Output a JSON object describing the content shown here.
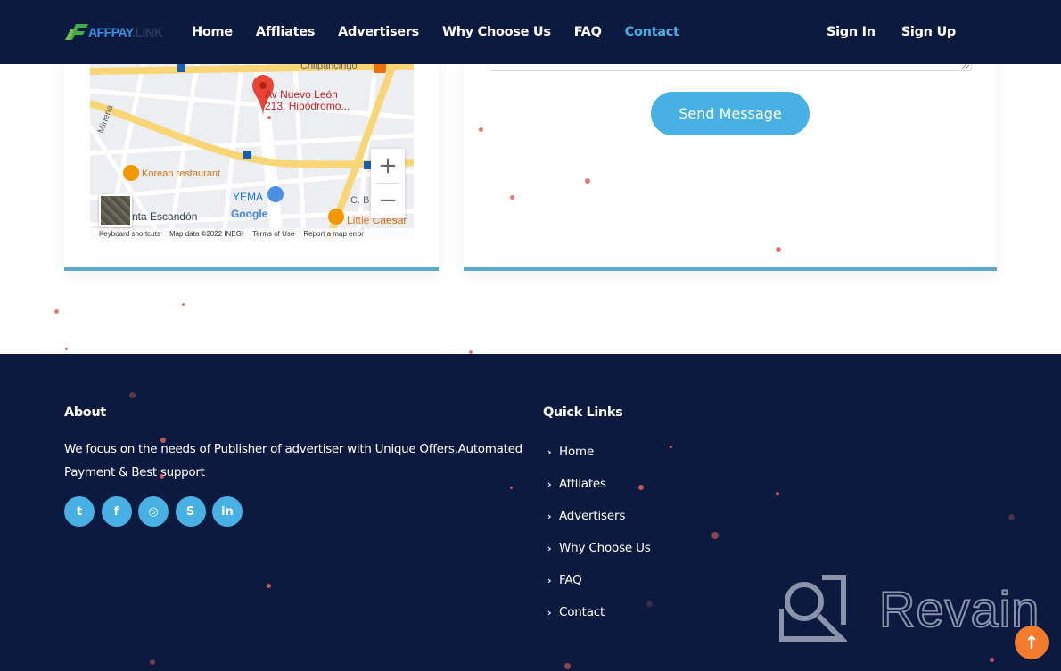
{
  "navbar": {
    "logo": {
      "part1": "AFFPAY",
      "part2": ".LINK"
    },
    "links": [
      {
        "label": "Home",
        "active": false
      },
      {
        "label": "Affliates",
        "active": false
      },
      {
        "label": "Advertisers",
        "active": false
      },
      {
        "label": "Why Choose Us",
        "active": false
      },
      {
        "label": "FAQ",
        "active": false
      },
      {
        "label": "Contact",
        "active": true
      }
    ],
    "sign_in": "Sign In",
    "sign_up": "Sign Up"
  },
  "map": {
    "place_line1": "Av Nuevo León",
    "place_line2": "213, Hipódromo...",
    "labels": {
      "korean": "Korean restaurant",
      "yema": "YEMA",
      "escandon": "nta Escandón",
      "caesar": "Little Caesar",
      "mineria": "Mineria",
      "chilpancingo": "Chilpancingo",
      "cba": "C. B",
      "google": "Google"
    },
    "zoom_in": "+",
    "zoom_out": "−",
    "footer": {
      "shortcuts": "Keyboard shortcuts",
      "map_data": "Map data ©2022 INEGI",
      "terms": "Terms of Use",
      "report": "Report a map error"
    }
  },
  "contact_form": {
    "message_value": "",
    "send_label": "Send Message"
  },
  "footer": {
    "about_heading": "About",
    "about_text": "We focus on the needs of Publisher of advertiser with Unique Offers,Automated Payment & Best support",
    "socials": [
      {
        "name": "twitter",
        "glyph": "t"
      },
      {
        "name": "facebook",
        "glyph": "f"
      },
      {
        "name": "instagram",
        "glyph": "◎"
      },
      {
        "name": "skype",
        "glyph": "S"
      },
      {
        "name": "linkedin",
        "glyph": "in"
      }
    ],
    "quick_links_heading": "Quick Links",
    "quick_links": [
      "Home",
      "Affliates",
      "Advertisers",
      "Why Choose Us",
      "FAQ",
      "Contact"
    ],
    "watermark": "Revain",
    "back_to_top": "↑"
  },
  "colors": {
    "navy": "#0d1a40",
    "accent_blue": "#48b0e2",
    "orange": "#f27c2b"
  }
}
